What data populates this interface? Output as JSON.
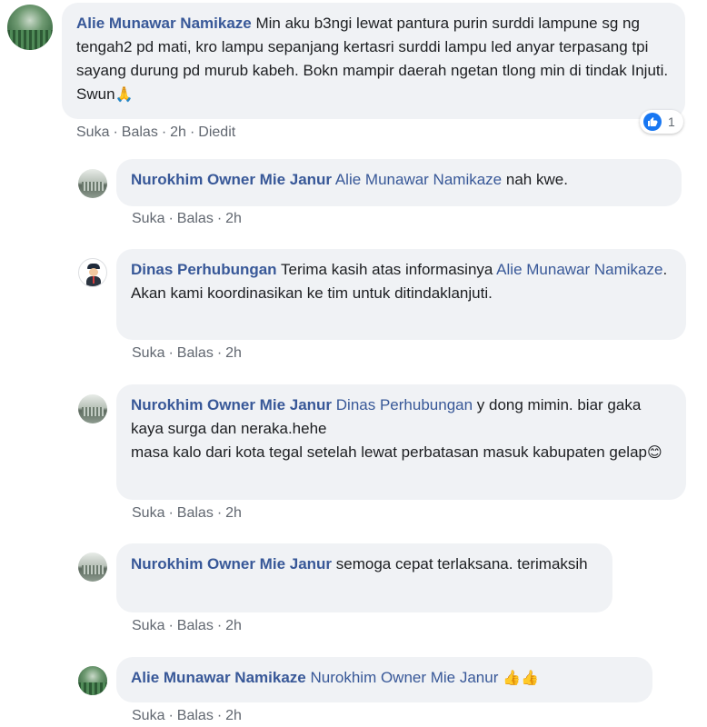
{
  "comments": [
    {
      "author": "Alie Munawar Namikaze",
      "text": "Min aku b3ngi lewat pantura purin surddi lampune sg ng tengah2 pd mati, kro lampu sepanjang kertasri surddi lampu led anyar terpasang tpi sayang durung pd murub kabeh. Bokn mampir daerah ngetan tlong min di tindak Injuti. Swun",
      "emoji": "🙏",
      "actions": {
        "like": "Suka",
        "reply": "Balas",
        "time": "2h",
        "edited": "Diedit"
      },
      "reaction_count": "1"
    },
    {
      "author": "Nurokhim Owner Mie Janur",
      "mention": "Alie Munawar Namikaze",
      "text": "nah kwe.",
      "actions": {
        "like": "Suka",
        "reply": "Balas",
        "time": "2h"
      }
    },
    {
      "author": "Dinas Perhubungan",
      "text_before": "Terima kasih atas informasinya",
      "mention": "Alie Munawar Namikaze",
      "text": ". Akan kami koordinasikan ke tim untuk ditindaklanjuti.",
      "actions": {
        "like": "Suka",
        "reply": "Balas",
        "time": "2h"
      }
    },
    {
      "author": "Nurokhim Owner Mie Janur",
      "mention": "Dinas Perhubungan",
      "text": "y dong mimin. biar gaka kaya surga dan neraka.hehe",
      "text2": "masa kalo dari kota tegal setelah lewat perbatasan masuk kabupaten gelap",
      "emoji": "😊",
      "actions": {
        "like": "Suka",
        "reply": "Balas",
        "time": "2h"
      }
    },
    {
      "author": "Nurokhim Owner Mie Janur",
      "text": "semoga cepat terlaksana. terimaksih",
      "actions": {
        "like": "Suka",
        "reply": "Balas",
        "time": "2h"
      }
    },
    {
      "author": "Alie Munawar Namikaze",
      "mention": "Nurokhim Owner Mie Janur",
      "emoji": "👍👍",
      "actions": {
        "like": "Suka",
        "reply": "Balas",
        "time": "2h"
      }
    }
  ],
  "colors": {
    "author": "#385898",
    "bubble": "#f0f2f5",
    "meta": "#616770",
    "like": "#1877f2"
  }
}
